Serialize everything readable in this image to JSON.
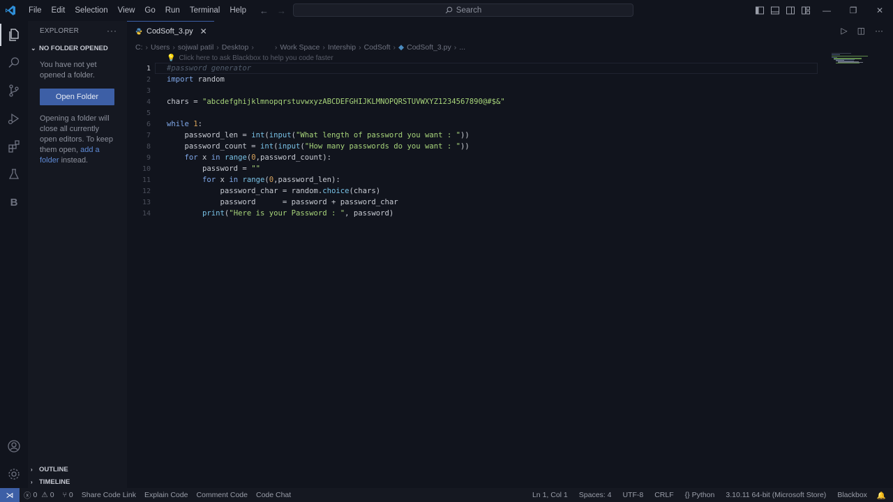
{
  "menu": [
    "File",
    "Edit",
    "Selection",
    "View",
    "Go",
    "Run",
    "Terminal",
    "Help"
  ],
  "search": {
    "placeholder": "Search"
  },
  "sidebar": {
    "title": "EXPLORER",
    "section": "NO FOLDER OPENED",
    "no_folder_text": "You have not yet opened a folder.",
    "open_button": "Open Folder",
    "info_pre": "Opening a folder will close all currently open editors. To keep them open, ",
    "info_link": "add a folder",
    "info_post": " instead.",
    "outline": "OUTLINE",
    "timeline": "TIMELINE"
  },
  "tab": {
    "name": "CodSoft_3.py"
  },
  "breadcrumb": [
    "C:",
    "Users",
    "sojwal patil",
    "Desktop",
    "",
    "Work Space",
    "Intership",
    "CodSoft",
    "CodSoft_3.py",
    "..."
  ],
  "code_hint": "Click here to ask Blackbox to help you code faster",
  "code": {
    "l1": "#password generator",
    "l2_kw": "import",
    "l2_rest": " random",
    "l4_a": "chars = ",
    "l4_str": "\"abcdefghijklmnopqrstuvwxyzABCDEFGHIJKLMNOPQRSTUVWXYZ1234567890@#$&\"",
    "l6_kw": "while",
    "l6_num": " 1",
    "l6_rest": ":",
    "l7_a": "    password_len = ",
    "l7_fn1": "int",
    "l7_b": "(",
    "l7_fn2": "input",
    "l7_c": "(",
    "l7_str": "\"What length of password you want : \"",
    "l7_d": "))",
    "l8_a": "    password_count = ",
    "l8_fn1": "int",
    "l8_b": "(",
    "l8_fn2": "input",
    "l8_c": "(",
    "l8_str": "\"How many passwords do you want : \"",
    "l8_d": "))",
    "l9_kw1": "    for",
    "l9_a": " x ",
    "l9_kw2": "in",
    "l9_b": " ",
    "l9_fn": "range",
    "l9_c": "(",
    "l9_num": "0",
    "l9_d": ",password_count):",
    "l10_a": "        password = ",
    "l10_str": "\"\"",
    "l11_kw1": "        for",
    "l11_a": " x ",
    "l11_kw2": "in",
    "l11_b": " ",
    "l11_fn": "range",
    "l11_c": "(",
    "l11_num": "0",
    "l11_d": ",password_len):",
    "l12_a": "            password_char = random.",
    "l12_fn": "choice",
    "l12_b": "(chars)",
    "l13_a": "            password      = password + password_char",
    "l14_fn": "        print",
    "l14_a": "(",
    "l14_str": "\"Here is your Password : \"",
    "l14_b": ", password)"
  },
  "line_numbers": [
    "1",
    "2",
    "3",
    "4",
    "5",
    "6",
    "7",
    "8",
    "9",
    "10",
    "11",
    "12",
    "13",
    "14"
  ],
  "status": {
    "errors": "0",
    "warnings": "0",
    "ports": "0",
    "share": "Share Code Link",
    "explain": "Explain Code",
    "comment": "Comment Code",
    "chat": "Code Chat",
    "position": "Ln 1, Col 1",
    "spaces": "Spaces: 4",
    "encoding": "UTF-8",
    "eol": "CRLF",
    "language": "Python",
    "interpreter": "3.10.11 64-bit (Microsoft Store)",
    "blackbox": "Blackbox"
  },
  "colors": {
    "accent": "#3d5fa6",
    "background": "#11141d",
    "sidebar": "#151821"
  }
}
